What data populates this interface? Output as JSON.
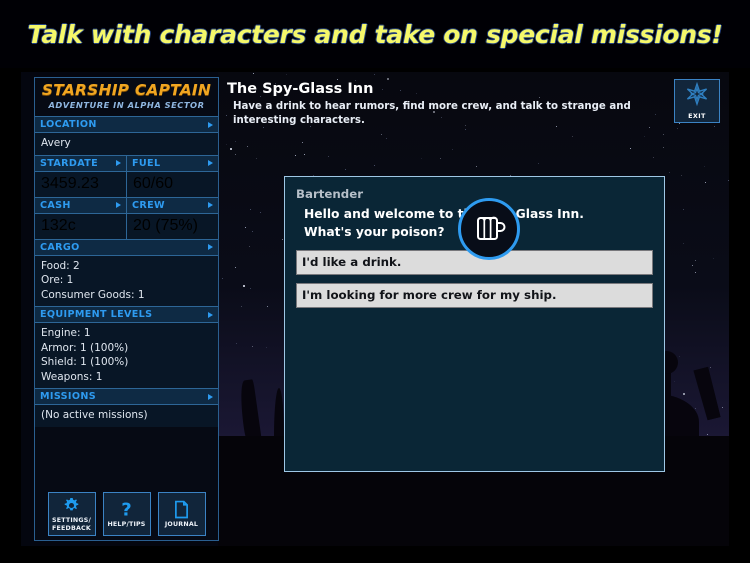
{
  "headline": "Talk with characters and take on special missions!",
  "sidebar": {
    "logo_title": "STARSHIP CAPTAIN",
    "logo_subtitle": "ADVENTURE IN ALPHA SECTOR",
    "sections": {
      "location_label": "LOCATION",
      "location_value": "Avery",
      "stardate_label": "STARDATE",
      "stardate_value": "3459.23",
      "fuel_label": "FUEL",
      "fuel_value": "60/60",
      "cash_label": "CASH",
      "cash_value": "132c",
      "crew_label": "CREW",
      "crew_value": "20 (75%)",
      "cargo_label": "CARGO",
      "cargo_items": [
        "Food: 2",
        "Ore: 1",
        "Consumer Goods: 1"
      ],
      "equipment_label": "EQUIPMENT LEVELS",
      "equipment_items": [
        "Engine: 1",
        "Armor: 1 (100%)",
        "Shield: 1 (100%)",
        "Weapons: 1"
      ],
      "missions_label": "MISSIONS",
      "missions_value": "(No active missions)"
    },
    "buttons": [
      {
        "icon": "gear-icon",
        "line1": "SETTINGS/",
        "line2": "FEEDBACK"
      },
      {
        "icon": "question-mark-icon",
        "line1": "HELP/TIPS",
        "line2": ""
      },
      {
        "icon": "journal-page-icon",
        "line1": "JOURNAL",
        "line2": ""
      }
    ]
  },
  "scene": {
    "title": "The Spy-Glass Inn",
    "subtitle": "Have a drink to hear rumors, find more crew, and talk to strange and interesting characters.",
    "exit_label": "EXIT",
    "exit_icon": "compass-star-icon",
    "avatar_icon": "beer-mug-icon"
  },
  "dialog": {
    "npc_name": "Bartender",
    "lines": [
      "Hello and welcome to the Spy-Glass Inn.",
      "What's your poison?"
    ],
    "options": [
      "I'd like a drink.",
      "I'm looking for more crew for my ship."
    ]
  },
  "colors": {
    "accent_blue": "#2e9bf0",
    "logo_gold": "#f0a621",
    "headline_yellow": "#f5f86a",
    "dialog_bg": "#0a2636",
    "option_bg": "#dcdcdc"
  }
}
